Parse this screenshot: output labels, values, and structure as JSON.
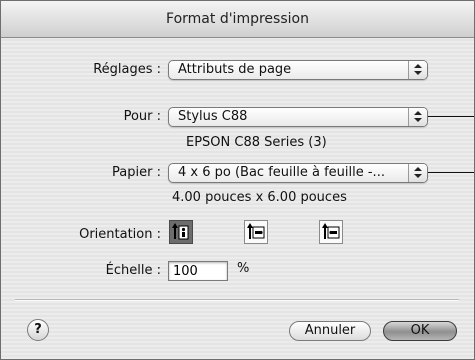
{
  "window": {
    "title": "Format d'impression"
  },
  "settings": {
    "label": "Réglages :",
    "value": "Attributs de page"
  },
  "format_for": {
    "label": "Pour :",
    "value": "Stylus C88",
    "description": "EPSON C88 Series (3)"
  },
  "paper": {
    "label": "Papier :",
    "value": "4 x 6 po (Bac feuille à feuille -...",
    "dimensions": "4.00 pouces x 6.00 pouces"
  },
  "orientation": {
    "label": "Orientation :",
    "options": [
      "portrait",
      "landscape-left",
      "landscape-right"
    ],
    "selected": "portrait"
  },
  "scale": {
    "label": "Échelle :",
    "value": "100",
    "unit": "%"
  },
  "buttons": {
    "help": "?",
    "cancel": "Annuler",
    "ok": "OK"
  }
}
